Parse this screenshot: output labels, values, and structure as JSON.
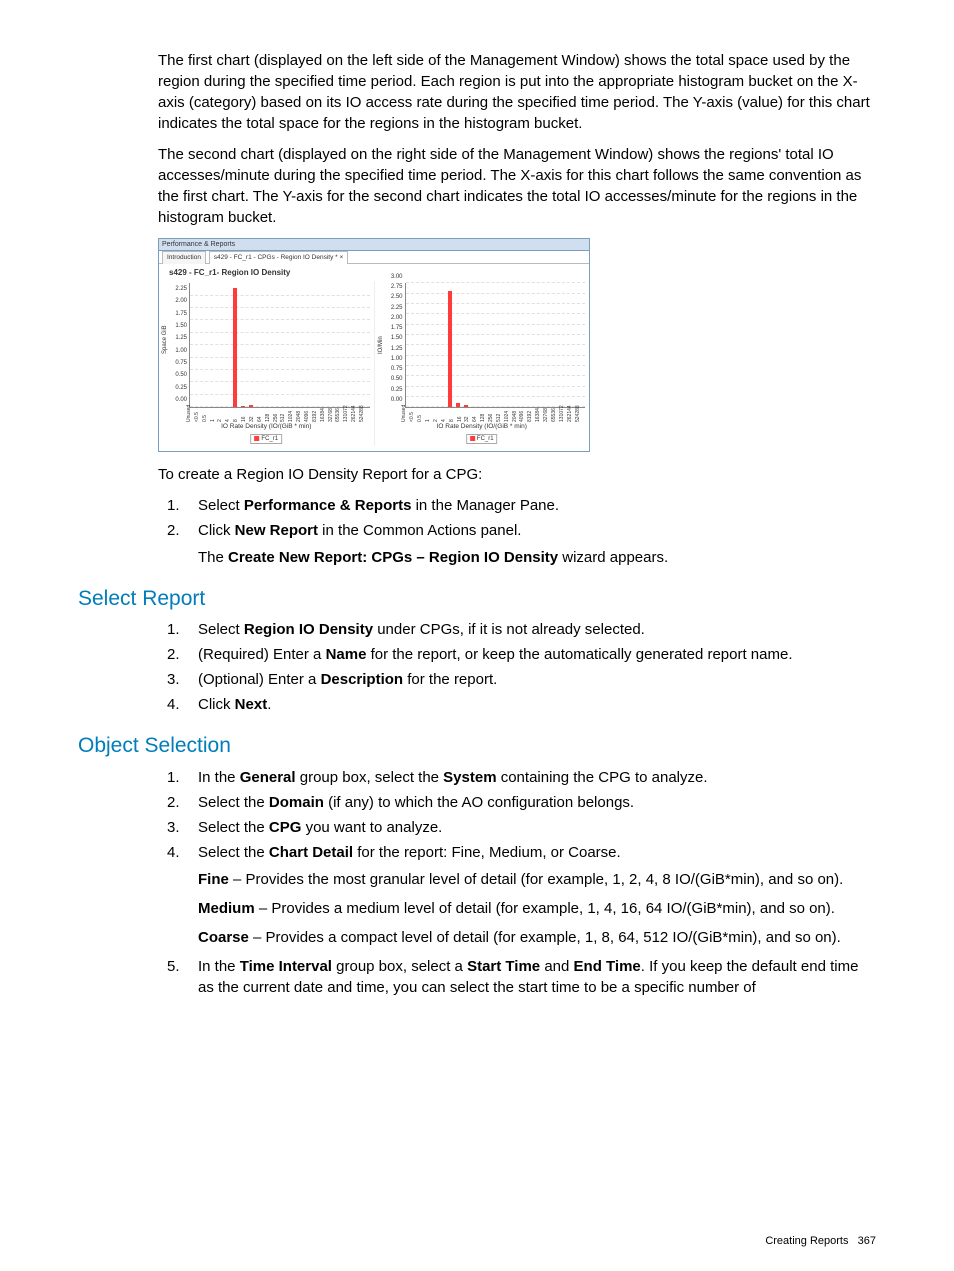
{
  "intro": {
    "p1": "The first chart (displayed on the left side of the Management Window) shows the total space used by the region during the specified time period. Each region is put into the appropriate histogram bucket on the X-axis (category) based on its IO access rate during the specified time period. The Y-axis (value) for this chart indicates the total space for the regions in the histogram bucket.",
    "p2": "The second chart (displayed on the right side of the Management Window) shows the regions' total IO accesses/minute during the specified time period. The X-axis for this chart follows the same convention as the first chart. The Y-axis for the second chart indicates the total IO accesses/minute for the regions in the histogram bucket."
  },
  "chart_window": {
    "titlebar": "Performance & Reports",
    "tab_intro": "Introduction",
    "tab_active": "s429 - FC_r1 - CPGs - Region IO Density *  ×",
    "chart_title": "s429 - FC_r1- Region IO Density"
  },
  "chart_data": [
    {
      "type": "bar",
      "title": "",
      "ylabel": "Space GiB",
      "xlabel": "IO Rate Density (IO/(GiB * min)",
      "ylim": [
        0,
        2.5
      ],
      "yticks": [
        "0.00",
        "0.25",
        "0.50",
        "0.75",
        "1.00",
        "1.25",
        "1.50",
        "1.75",
        "2.00",
        "2.25"
      ],
      "categories": [
        "Unused",
        "<0.5",
        "0.5",
        "1",
        "2",
        "4",
        "8",
        "16",
        "32",
        "64",
        "128",
        "256",
        "512",
        "1024",
        "2048",
        "4096",
        "8192",
        "16384",
        "32768",
        "65536",
        "131072",
        "262144",
        "524288"
      ],
      "series": [
        {
          "name": "FC_r1",
          "values": [
            0,
            0,
            0,
            0,
            0,
            2.4,
            0.03,
            0.05,
            0,
            0,
            0,
            0,
            0,
            0,
            0,
            0,
            0,
            0,
            0,
            0,
            0,
            0,
            0
          ]
        }
      ],
      "legend": "FC_r1"
    },
    {
      "type": "bar",
      "title": "",
      "ylabel": "IO/Min",
      "xlabel": "IO Rate Density (IO/(GiB * min)",
      "ylim": [
        0,
        3.0
      ],
      "yticks": [
        "0.00",
        "0.25",
        "0.50",
        "0.75",
        "1.00",
        "1.25",
        "1.50",
        "1.75",
        "2.00",
        "2.25",
        "2.50",
        "2.75",
        "3.00"
      ],
      "categories": [
        "Unused",
        "<0.5",
        "0.5",
        "1",
        "2",
        "4",
        "8",
        "16",
        "32",
        "64",
        "128",
        "256",
        "512",
        "1024",
        "2048",
        "4096",
        "8192",
        "16384",
        "32768",
        "65536",
        "131072",
        "262144",
        "524288"
      ],
      "series": [
        {
          "name": "FC_r1",
          "values": [
            0,
            0,
            0,
            0,
            0,
            2.8,
            0.1,
            0.05,
            0,
            0,
            0,
            0,
            0,
            0,
            0,
            0,
            0,
            0,
            0,
            0,
            0,
            0,
            0
          ]
        }
      ],
      "legend": "FC_r1"
    }
  ],
  "create_intro": "To create a Region IO Density Report for a CPG:",
  "create_steps": {
    "s1a": "Select ",
    "s1b": "Performance & Reports",
    "s1c": " in the Manager Pane.",
    "s2a": "Click ",
    "s2b": "New Report",
    "s2c": " in the Common Actions panel.",
    "s2suba": "The ",
    "s2subb": "Create New Report: CPGs – Region IO Density",
    "s2subc": " wizard appears."
  },
  "sections": {
    "select_report": "Select Report",
    "object_selection": "Object Selection"
  },
  "select_report_steps": {
    "s1a": "Select ",
    "s1b": "Region IO Density",
    "s1c": " under CPGs, if it is not already selected.",
    "s2a": "(Required) Enter a ",
    "s2b": "Name",
    "s2c": " for the report, or keep the automatically generated report name.",
    "s3a": "(Optional) Enter a ",
    "s3b": "Description",
    "s3c": " for the report.",
    "s4a": "Click ",
    "s4b": "Next",
    "s4c": "."
  },
  "object_selection_steps": {
    "s1a": "In the ",
    "s1b": "General",
    "s1c": " group box, select the ",
    "s1d": "System",
    "s1e": " containing the CPG to analyze.",
    "s2a": "Select the ",
    "s2b": "Domain",
    "s2c": " (if any) to which the AO configuration belongs.",
    "s3a": "Select the ",
    "s3b": "CPG",
    "s3c": " you want to analyze.",
    "s4a": "Select the ",
    "s4b": "Chart Detail",
    "s4c": " for the report: Fine, Medium, or Coarse.",
    "s4_fine_a": "Fine",
    "s4_fine_b": " – Provides the most granular level of detail (for example, 1, 2, 4, 8 IO/(GiB*min), and so on).",
    "s4_med_a": "Medium",
    "s4_med_b": " – Provides a medium level of detail (for example, 1, 4, 16, 64 IO/(GiB*min), and so on).",
    "s4_coarse_a": "Coarse",
    "s4_coarse_b": " – Provides a compact level of detail (for example, 1, 8, 64, 512 IO/(GiB*min), and so on).",
    "s5a": "In the ",
    "s5b": "Time Interval",
    "s5c": " group box, select a ",
    "s5d": "Start Time",
    "s5e": " and ",
    "s5f": "End Time",
    "s5g": ". If you keep the default end time as the current date and time, you can select the start time to be a specific number of"
  },
  "footer": {
    "label": "Creating Reports",
    "page": "367"
  }
}
